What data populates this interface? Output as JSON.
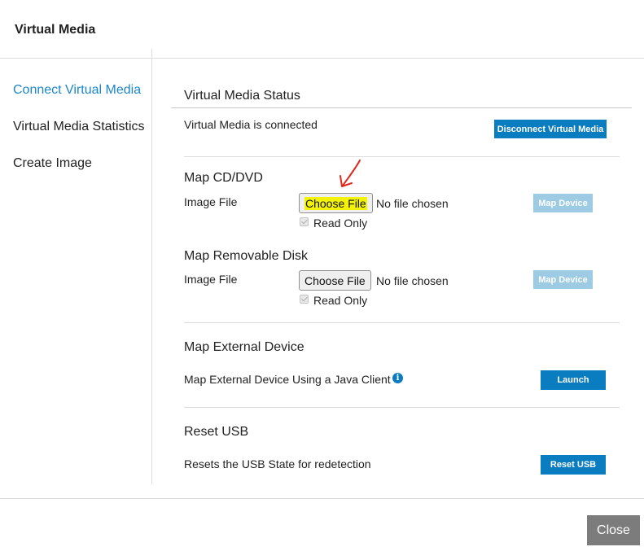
{
  "dialog": {
    "title": "Virtual Media",
    "close_label": "Close"
  },
  "colors": {
    "accent": "#0a7cc0",
    "nav_active": "#1c87c9",
    "disabled_button": "#9dcbe3",
    "highlight": "#f2f20a",
    "annotation_arrow": "#e0271c"
  },
  "nav": {
    "items": [
      {
        "label": "Connect Virtual Media",
        "active": true
      },
      {
        "label": "Virtual Media Statistics",
        "active": false
      },
      {
        "label": "Create Image",
        "active": false
      }
    ]
  },
  "status": {
    "heading": "Virtual Media Status",
    "text": "Virtual Media is connected",
    "disconnect_label": "Disconnect Virtual Media"
  },
  "cd_dvd": {
    "heading": "Map CD/DVD",
    "field_label": "Image File",
    "choose_label": "Choose File",
    "file_state": "No file chosen",
    "read_only_label": "Read Only",
    "map_label": "Map Device"
  },
  "removable": {
    "heading": "Map Removable Disk",
    "field_label": "Image File",
    "choose_label": "Choose File",
    "file_state": "No file chosen",
    "read_only_label": "Read Only",
    "map_label": "Map Device"
  },
  "external": {
    "heading": "Map External Device",
    "text": "Map External Device Using a Java Client",
    "info_glyph": "i",
    "launch_label": "Launch"
  },
  "reset": {
    "heading": "Reset USB",
    "text": "Resets the USB State for redetection",
    "reset_label": "Reset USB"
  }
}
